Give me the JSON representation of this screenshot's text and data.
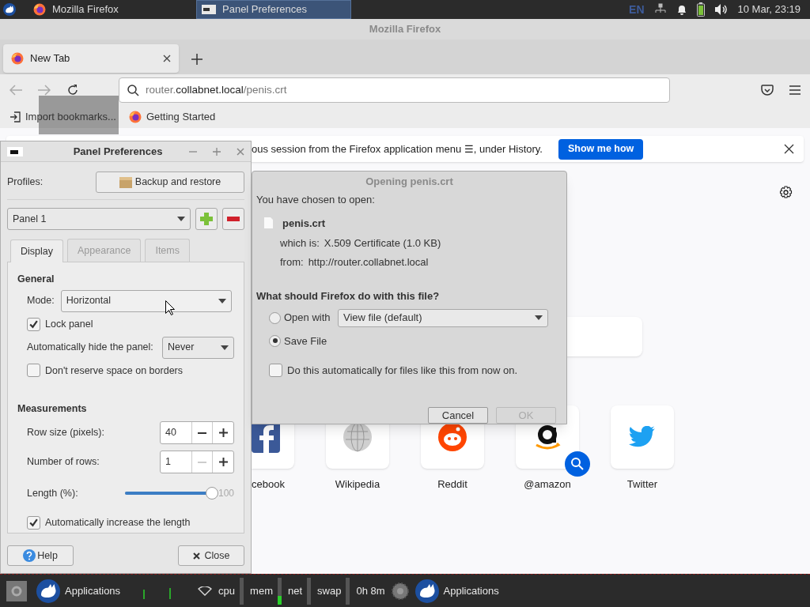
{
  "top_panel": {
    "tasks": [
      {
        "label": "Mozilla Firefox",
        "selected": false
      },
      {
        "label": "Panel Preferences",
        "selected": true
      }
    ],
    "keyboard_layout": "EN",
    "clock": "10 Mar, 23:19"
  },
  "firefox": {
    "title": "Mozilla Firefox",
    "tabs": [
      {
        "label": "New Tab",
        "selected": true
      }
    ],
    "url": {
      "prefix": "router.",
      "domain": "collabnet.local",
      "path": "/penis.crt"
    },
    "bookmarks": [
      {
        "label": "Import bookmarks...",
        "kind": "import"
      },
      {
        "label": "Getting Started",
        "kind": "firefox"
      }
    ],
    "notification": {
      "text": "ous session from the Firefox application menu ☰, under History.",
      "button": "Show me how"
    },
    "top_sites": [
      {
        "label": "cebook",
        "kind": "facebook",
        "partial": true,
        "search_shortcut": false
      },
      {
        "label": "Wikipedia",
        "kind": "wikipedia",
        "partial": false,
        "search_shortcut": false
      },
      {
        "label": "Reddit",
        "kind": "reddit",
        "partial": false,
        "search_shortcut": false
      },
      {
        "label": "@amazon",
        "kind": "amazon",
        "partial": false,
        "search_shortcut": true
      },
      {
        "label": "Twitter",
        "kind": "twitter",
        "partial": false,
        "search_shortcut": false
      }
    ]
  },
  "panel_preferences": {
    "title": "Panel Preferences",
    "profiles_label": "Profiles:",
    "backup_button": "Backup and restore",
    "panel_select": "Panel 1",
    "tabs": [
      {
        "label": "Display",
        "selected": true
      },
      {
        "label": "Appearance",
        "selected": false
      },
      {
        "label": "Items",
        "selected": false
      }
    ],
    "general_heading": "General",
    "mode_label": "Mode:",
    "mode_value": "Horizontal",
    "lock_panel": {
      "label": "Lock panel",
      "checked": true
    },
    "autohide_label": "Automatically hide the panel:",
    "autohide_value": "Never",
    "dont_reserve": {
      "label": "Don't reserve space on borders",
      "checked": false
    },
    "measurements_heading": "Measurements",
    "spins": [
      {
        "label": "Row size (pixels):",
        "value": "40",
        "minus_disabled": false
      },
      {
        "label": "Number of rows:",
        "value": "1",
        "minus_disabled": true
      }
    ],
    "length": {
      "label": "Length (%):",
      "level": 1.0,
      "reading": "100"
    },
    "auto_increase": {
      "label": "Automatically increase the length",
      "checked": true
    },
    "help_button": "Help",
    "close_button": "Close"
  },
  "dialog": {
    "title": "Opening penis.crt",
    "intro": "You have chosen to open:",
    "filename": "penis.crt",
    "which_label": "which is:",
    "which_value": "X.509 Certificate (1.0 KB)",
    "from_label": "from:",
    "from_value": "http://router.collabnet.local",
    "question": "What should Firefox do with this file?",
    "options": [
      {
        "label": "Open with",
        "selected": false,
        "app": "View file (default)"
      },
      {
        "label": "Save File",
        "selected": true
      }
    ],
    "auto": {
      "label": "Do this automatically for files like this from now on.",
      "checked": false
    },
    "buttons": [
      {
        "label": "Cancel",
        "disabled": false
      },
      {
        "label": "OK",
        "disabled": true
      }
    ]
  },
  "bottom_panel": {
    "apps_label": "Applications",
    "monitors": [
      {
        "label": "cpu",
        "level": 0
      },
      {
        "label": "mem",
        "level": 0.3
      },
      {
        "label": "net",
        "level": 0
      },
      {
        "label": "swap",
        "level": 0
      }
    ],
    "uptime": "0h 8m",
    "apps_label_2": "Applications"
  }
}
